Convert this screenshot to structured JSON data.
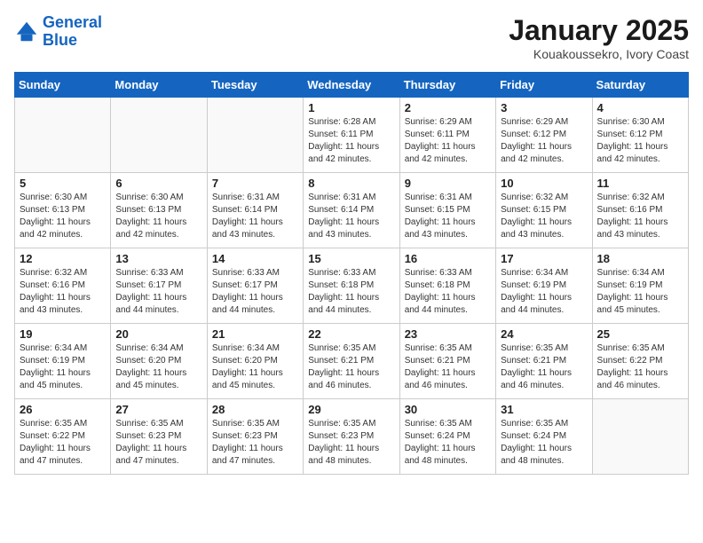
{
  "header": {
    "logo_line1": "General",
    "logo_line2": "Blue",
    "month": "January 2025",
    "location": "Kouakoussekro, Ivory Coast"
  },
  "weekdays": [
    "Sunday",
    "Monday",
    "Tuesday",
    "Wednesday",
    "Thursday",
    "Friday",
    "Saturday"
  ],
  "weeks": [
    [
      {
        "day": "",
        "info": ""
      },
      {
        "day": "",
        "info": ""
      },
      {
        "day": "",
        "info": ""
      },
      {
        "day": "1",
        "info": "Sunrise: 6:28 AM\nSunset: 6:11 PM\nDaylight: 11 hours\nand 42 minutes."
      },
      {
        "day": "2",
        "info": "Sunrise: 6:29 AM\nSunset: 6:11 PM\nDaylight: 11 hours\nand 42 minutes."
      },
      {
        "day": "3",
        "info": "Sunrise: 6:29 AM\nSunset: 6:12 PM\nDaylight: 11 hours\nand 42 minutes."
      },
      {
        "day": "4",
        "info": "Sunrise: 6:30 AM\nSunset: 6:12 PM\nDaylight: 11 hours\nand 42 minutes."
      }
    ],
    [
      {
        "day": "5",
        "info": "Sunrise: 6:30 AM\nSunset: 6:13 PM\nDaylight: 11 hours\nand 42 minutes."
      },
      {
        "day": "6",
        "info": "Sunrise: 6:30 AM\nSunset: 6:13 PM\nDaylight: 11 hours\nand 42 minutes."
      },
      {
        "day": "7",
        "info": "Sunrise: 6:31 AM\nSunset: 6:14 PM\nDaylight: 11 hours\nand 43 minutes."
      },
      {
        "day": "8",
        "info": "Sunrise: 6:31 AM\nSunset: 6:14 PM\nDaylight: 11 hours\nand 43 minutes."
      },
      {
        "day": "9",
        "info": "Sunrise: 6:31 AM\nSunset: 6:15 PM\nDaylight: 11 hours\nand 43 minutes."
      },
      {
        "day": "10",
        "info": "Sunrise: 6:32 AM\nSunset: 6:15 PM\nDaylight: 11 hours\nand 43 minutes."
      },
      {
        "day": "11",
        "info": "Sunrise: 6:32 AM\nSunset: 6:16 PM\nDaylight: 11 hours\nand 43 minutes."
      }
    ],
    [
      {
        "day": "12",
        "info": "Sunrise: 6:32 AM\nSunset: 6:16 PM\nDaylight: 11 hours\nand 43 minutes."
      },
      {
        "day": "13",
        "info": "Sunrise: 6:33 AM\nSunset: 6:17 PM\nDaylight: 11 hours\nand 44 minutes."
      },
      {
        "day": "14",
        "info": "Sunrise: 6:33 AM\nSunset: 6:17 PM\nDaylight: 11 hours\nand 44 minutes."
      },
      {
        "day": "15",
        "info": "Sunrise: 6:33 AM\nSunset: 6:18 PM\nDaylight: 11 hours\nand 44 minutes."
      },
      {
        "day": "16",
        "info": "Sunrise: 6:33 AM\nSunset: 6:18 PM\nDaylight: 11 hours\nand 44 minutes."
      },
      {
        "day": "17",
        "info": "Sunrise: 6:34 AM\nSunset: 6:19 PM\nDaylight: 11 hours\nand 44 minutes."
      },
      {
        "day": "18",
        "info": "Sunrise: 6:34 AM\nSunset: 6:19 PM\nDaylight: 11 hours\nand 45 minutes."
      }
    ],
    [
      {
        "day": "19",
        "info": "Sunrise: 6:34 AM\nSunset: 6:19 PM\nDaylight: 11 hours\nand 45 minutes."
      },
      {
        "day": "20",
        "info": "Sunrise: 6:34 AM\nSunset: 6:20 PM\nDaylight: 11 hours\nand 45 minutes."
      },
      {
        "day": "21",
        "info": "Sunrise: 6:34 AM\nSunset: 6:20 PM\nDaylight: 11 hours\nand 45 minutes."
      },
      {
        "day": "22",
        "info": "Sunrise: 6:35 AM\nSunset: 6:21 PM\nDaylight: 11 hours\nand 46 minutes."
      },
      {
        "day": "23",
        "info": "Sunrise: 6:35 AM\nSunset: 6:21 PM\nDaylight: 11 hours\nand 46 minutes."
      },
      {
        "day": "24",
        "info": "Sunrise: 6:35 AM\nSunset: 6:21 PM\nDaylight: 11 hours\nand 46 minutes."
      },
      {
        "day": "25",
        "info": "Sunrise: 6:35 AM\nSunset: 6:22 PM\nDaylight: 11 hours\nand 46 minutes."
      }
    ],
    [
      {
        "day": "26",
        "info": "Sunrise: 6:35 AM\nSunset: 6:22 PM\nDaylight: 11 hours\nand 47 minutes."
      },
      {
        "day": "27",
        "info": "Sunrise: 6:35 AM\nSunset: 6:23 PM\nDaylight: 11 hours\nand 47 minutes."
      },
      {
        "day": "28",
        "info": "Sunrise: 6:35 AM\nSunset: 6:23 PM\nDaylight: 11 hours\nand 47 minutes."
      },
      {
        "day": "29",
        "info": "Sunrise: 6:35 AM\nSunset: 6:23 PM\nDaylight: 11 hours\nand 48 minutes."
      },
      {
        "day": "30",
        "info": "Sunrise: 6:35 AM\nSunset: 6:24 PM\nDaylight: 11 hours\nand 48 minutes."
      },
      {
        "day": "31",
        "info": "Sunrise: 6:35 AM\nSunset: 6:24 PM\nDaylight: 11 hours\nand 48 minutes."
      },
      {
        "day": "",
        "info": ""
      }
    ]
  ]
}
